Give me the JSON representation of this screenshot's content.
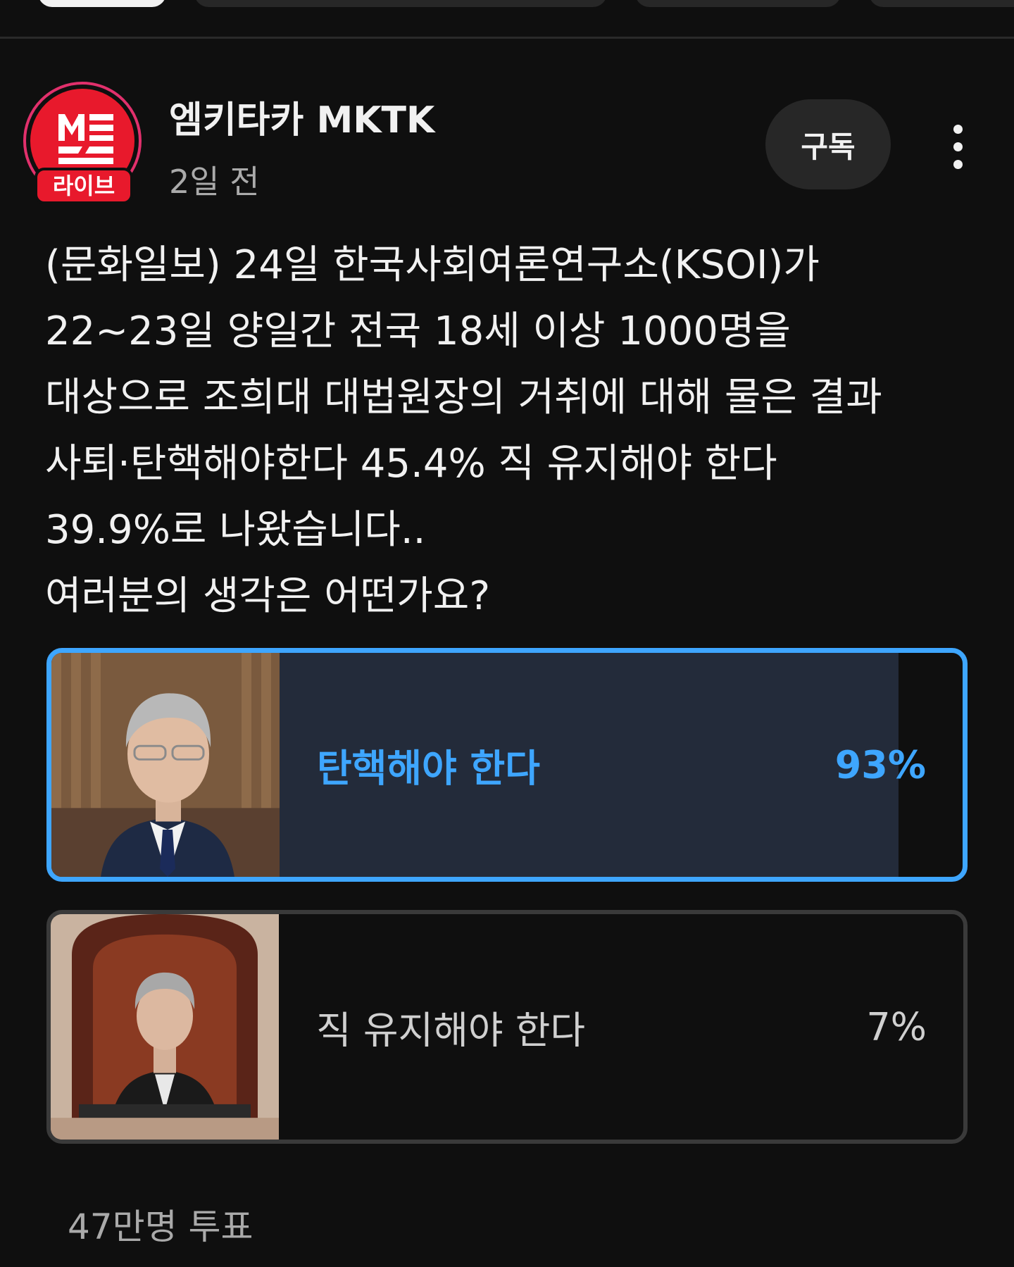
{
  "channel": {
    "name": "엠키타카 MKTK",
    "live_badge": "라이브",
    "time_ago": "2일 전"
  },
  "actions": {
    "subscribe_label": "구독"
  },
  "post": {
    "lines": [
      "(문화일보) 24일 한국사회여론연구소(KSOI)가",
      "22~23일 양일간 전국 18세 이상 1000명을",
      "대상으로 조희대 대법원장의 거취에 대해 물은 결과",
      "사퇴·탄핵해야한다 45.4% 직 유지해야 한다",
      "39.9%로 나왔습니다..",
      "여러분의 생각은 어떤가요?"
    ]
  },
  "poll": {
    "options": [
      {
        "label": "탄핵해야 한다",
        "percent_text": "93%",
        "fraction": 0.93,
        "selected": true
      },
      {
        "label": "직 유지해야 한다",
        "percent_text": "7%",
        "fraction": 0.07,
        "selected": false
      }
    ],
    "vote_count": "47만명 투표"
  },
  "colors": {
    "background": "#0f0f0f",
    "accent": "#3ea6ff",
    "brand_red": "#e8192c"
  },
  "icons": {
    "more": "more-vertical-icon"
  }
}
